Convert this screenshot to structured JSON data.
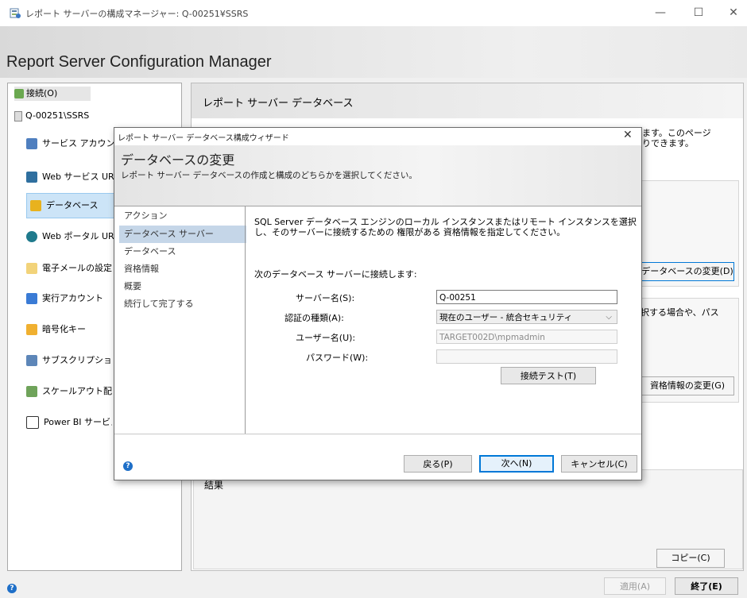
{
  "window": {
    "title": "レポート サーバーの構成マネージャー: Q-00251¥SSRS",
    "minimize": "—",
    "maximize": "☐",
    "close": "✕"
  },
  "header": {
    "title": "Report Server Configuration Manager"
  },
  "sidebar": {
    "connect": "接続(O)",
    "server": "Q-00251\\SSRS",
    "items": [
      {
        "label": "サービス アカウント",
        "icon": "service-account-icon"
      },
      {
        "label": "Web サービス URL",
        "icon": "web-service-url-icon"
      },
      {
        "label": "データベース",
        "icon": "database-icon"
      },
      {
        "label": "Web ポータル URL",
        "icon": "web-portal-icon"
      },
      {
        "label": "電子メールの設定",
        "icon": "email-icon"
      },
      {
        "label": "実行アカウント",
        "icon": "execution-account-icon"
      },
      {
        "label": "暗号化キー",
        "icon": "encryption-key-icon"
      },
      {
        "label": "サブスクリプションの",
        "icon": "subscription-icon"
      },
      {
        "label": "スケールアウト配置",
        "icon": "scale-out-icon"
      },
      {
        "label": "Power BI サービス",
        "icon": "power-bi-icon"
      }
    ]
  },
  "main": {
    "heading": "レポート サーバー データベース",
    "desc_line1": "ます。このページ",
    "desc_line2": "りできます。",
    "change_db_button": "データベースの変更(D)",
    "cred_line": "択する場合や、パス",
    "change_cred_button": "資格情報の変更(G)",
    "results_label": "結果",
    "copy_button": "コピー(C)"
  },
  "dialog": {
    "title": "レポート サーバー データベース構成ウィザード",
    "close": "✕",
    "heading": "データベースの変更",
    "subheading": "レポート サーバー データベースの作成と構成のどちらかを選択してください。",
    "steps": [
      "アクション",
      "データベース サーバー",
      "データベース",
      "資格情報",
      "概要",
      "続行して完了する"
    ],
    "instruction_line1": "SQL Server データベース エンジンのローカル インスタンスまたはリモート インスタンスを選択",
    "instruction_line2": "し、そのサーバーに接続するための 権限がある 資格情報を指定してください。",
    "connect_label": "次のデータベース サーバーに接続します:",
    "server_label": "サーバー名(S):",
    "server_value": "Q-00251",
    "auth_label": "認証の種類(A):",
    "auth_value": "現在のユーザー - 統合セキュリティ",
    "user_label": "ユーザー名(U):",
    "user_value": "TARGET002D\\mpmadmin",
    "password_label": "パスワード(W):",
    "password_value": "",
    "test_button": "接続テスト(T)",
    "back_button": "戻る(P)",
    "next_button": "次へ(N)",
    "cancel_button": "キャンセル(C)"
  },
  "footer": {
    "apply_button": "適用(A)",
    "exit_button": "終了(E)"
  }
}
